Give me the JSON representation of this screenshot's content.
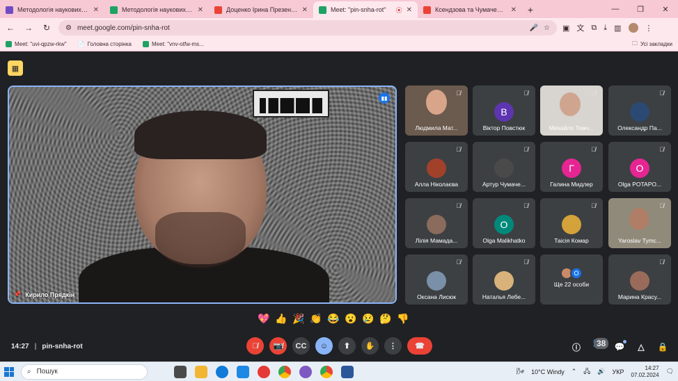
{
  "browser": {
    "tabs": [
      {
        "title": "Методологія наукових досліджень",
        "favicon_color": "#6f4cc4"
      },
      {
        "title": "Методологія наукових досліджень",
        "favicon_color": "#1ea362"
      },
      {
        "title": "Доценко Ірина Презентація - ...",
        "favicon_color": "#ea4335"
      },
      {
        "title": "Meet: \"pin-snha-rot\"",
        "favicon_color": "#1ea362",
        "active": true
      },
      {
        "title": "Ксендзова та Чумаченко презе...",
        "favicon_color": "#ea4335"
      }
    ],
    "new_tab": "+",
    "window_controls": [
      "—",
      "❐",
      "✕"
    ],
    "url": "meet.google.com/pin-snha-rot",
    "bookmarks": [
      {
        "label": "Meet: \"uvi-qpzw-rkw\""
      },
      {
        "label": "Головна сторінка"
      },
      {
        "label": "Meet: \"vnv-otfw-ms..."
      }
    ],
    "all_bookmarks": "Усі закладки"
  },
  "meet": {
    "main_speaker": {
      "name": "Кирило Прядкін"
    },
    "participants": [
      {
        "name": "Людмила Мат...",
        "type": "video"
      },
      {
        "name": "Віктор Повстюк",
        "initial": "В",
        "color": "#5e35b1"
      },
      {
        "name": "Михайло Томч...",
        "type": "video"
      },
      {
        "name": "Олександр Па...",
        "initial": "",
        "color": "#2b4a73"
      },
      {
        "name": "Алла Ніколаєва",
        "initial": "",
        "color": "#a2412a"
      },
      {
        "name": "Артур Чумаче...",
        "initial": "",
        "color": "#4a4a4a"
      },
      {
        "name": "Галина Мидлер",
        "initial": "Г",
        "color": "#e52592"
      },
      {
        "name": "Olga POTAPO...",
        "initial": "О",
        "color": "#e52592"
      },
      {
        "name": "Лілія Мамада...",
        "initial": "",
        "color": "#8a6b5c"
      },
      {
        "name": "Olga Malikhatko",
        "initial": "O",
        "color": "#00897b"
      },
      {
        "name": "Таісія Комар",
        "initial": "",
        "color": "#d4a23a"
      },
      {
        "name": "Yaroslav Tymc...",
        "type": "video"
      },
      {
        "name": "Оксана Лисюк",
        "initial": "",
        "color": "#7a8fa8"
      },
      {
        "name": "Наталья Лебе...",
        "initial": "",
        "color": "#d8b27a"
      },
      {
        "name": "Ще 22 особи",
        "type": "more",
        "more_initial": "O"
      },
      {
        "name": "Марина Красу...",
        "initial": "",
        "color": "#9a6b5a"
      }
    ],
    "reactions": [
      "💖",
      "👍",
      "🎉",
      "👏",
      "😂",
      "😮",
      "😢",
      "🤔",
      "👎"
    ],
    "time": "14:27",
    "meeting_code": "pin-snha-rot",
    "separator": "|",
    "people_count": "38"
  },
  "taskbar": {
    "search_placeholder": "Пошук",
    "weather": "10°C  Windy",
    "language": "УКР",
    "time": "14:27",
    "date": "07.02.2024"
  }
}
